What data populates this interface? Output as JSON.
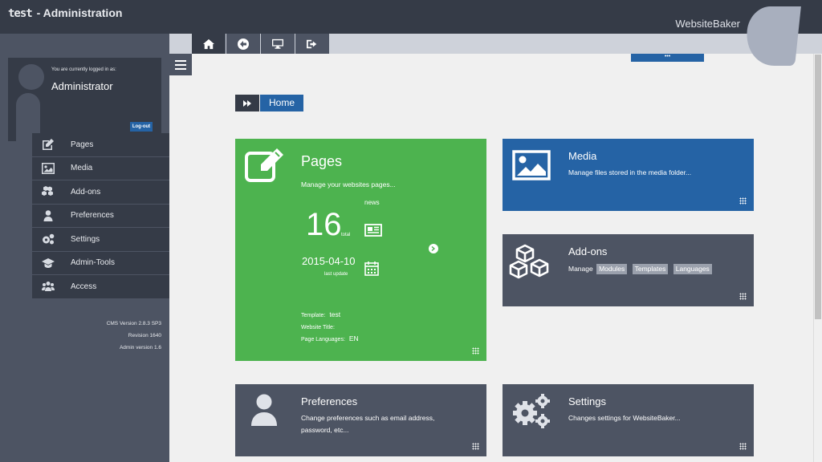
{
  "header": {
    "logo_text": "test",
    "title": " - Administration",
    "brand": "WebsiteBaker"
  },
  "user": {
    "logged_in_label": "You are currently logged in as:",
    "name": "Administrator",
    "logout_label": "Log-out"
  },
  "nav": {
    "items": [
      {
        "label": "Pages",
        "icon": "edit-icon"
      },
      {
        "label": "Media",
        "icon": "image-icon"
      },
      {
        "label": "Add-ons",
        "icon": "cubes-icon"
      },
      {
        "label": "Preferences",
        "icon": "user-icon"
      },
      {
        "label": "Settings",
        "icon": "gears-icon"
      },
      {
        "label": "Admin-Tools",
        "icon": "graduation-cap-icon"
      },
      {
        "label": "Access",
        "icon": "users-icon"
      }
    ]
  },
  "version": {
    "cms": "CMS Version 2.8.3 SP3",
    "revision": "Revision 1640",
    "admin": "Admin version 1.6"
  },
  "toolbar": {
    "buttons": [
      "home-icon",
      "back-icon",
      "desktop-icon",
      "sign-out-icon"
    ],
    "dots_label": "•••"
  },
  "breadcrumb": {
    "home": "Home"
  },
  "tiles": {
    "pages": {
      "title": "Pages",
      "desc": "Manage your websites pages...",
      "news_label": "news",
      "count": "16",
      "count_label": "total",
      "last_date": "2015-04-10",
      "last_label": "last update",
      "template_label": "Template:",
      "template_value": "test",
      "website_title_label": "Website Title:",
      "website_title_value": "",
      "languages_label": "Page Languages:",
      "languages_value": "EN"
    },
    "media": {
      "title": "Media",
      "desc": "Manage files stored in the media folder..."
    },
    "addons": {
      "title": "Add-ons",
      "manage": "Manage",
      "modules": "Modules",
      "templates": "Templates",
      "languages": "Languages"
    },
    "preferences": {
      "title": "Preferences",
      "desc_line1": "Change preferences such as email address,",
      "desc_line2": "password, etc..."
    },
    "settings": {
      "title": "Settings",
      "desc": "Changes settings for WebsiteBaker..."
    }
  },
  "colors": {
    "dark": "#353b47",
    "slate": "#4d5463",
    "green": "#4db34f",
    "blue": "#2563a5"
  }
}
